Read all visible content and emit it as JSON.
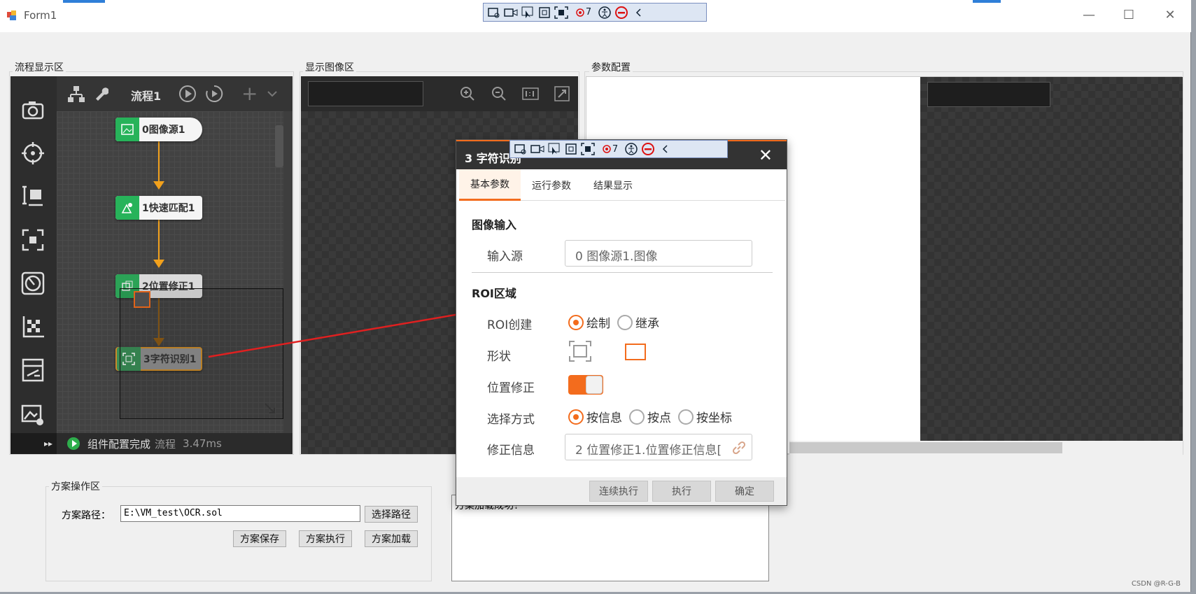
{
  "window": {
    "title": "Form1",
    "min": "—",
    "max": "☐",
    "close": "✕"
  },
  "float_toolbar": {
    "count": "7"
  },
  "groups": {
    "flow": "流程显示区",
    "image": "显示图像区",
    "param": "参数配置",
    "scheme": "方案操作区"
  },
  "flow": {
    "tab_title": "流程1",
    "nodes": [
      {
        "label": "0图像源1"
      },
      {
        "label": "1快速匹配1"
      },
      {
        "label": "2位置修正1"
      },
      {
        "label": "3字符识别1"
      }
    ],
    "status": {
      "text": "组件配置完成",
      "flow": "流程",
      "time": "3.47ms"
    }
  },
  "dialog": {
    "title": "3 字符识别",
    "tabs": [
      "基本参数",
      "运行参数",
      "结果显示"
    ],
    "section_image": "图像输入",
    "input_label": "输入源",
    "input_value": "0 图像源1.图像",
    "section_roi": "ROI区域",
    "roi_create_label": "ROI创建",
    "roi_opts": [
      "绘制",
      "继承"
    ],
    "shape_label": "形状",
    "pos_fix_label": "位置修正",
    "select_label": "选择方式",
    "select_opts": [
      "按信息",
      "按点",
      "按坐标"
    ],
    "fix_info_label": "修正信息",
    "fix_info_value": "2 位置修正1.位置修正信息[",
    "buttons": [
      "连续执行",
      "执行",
      "确定"
    ]
  },
  "scheme": {
    "path_label": "方案路径：",
    "path_value": "E:\\VM_test\\OCR.sol",
    "choose_path": "选择路径",
    "save": "方案保存",
    "run": "方案执行",
    "load": "方案加载"
  },
  "log": {
    "text": "方案加载成功！"
  },
  "watermark": "CSDN @R-G-B"
}
